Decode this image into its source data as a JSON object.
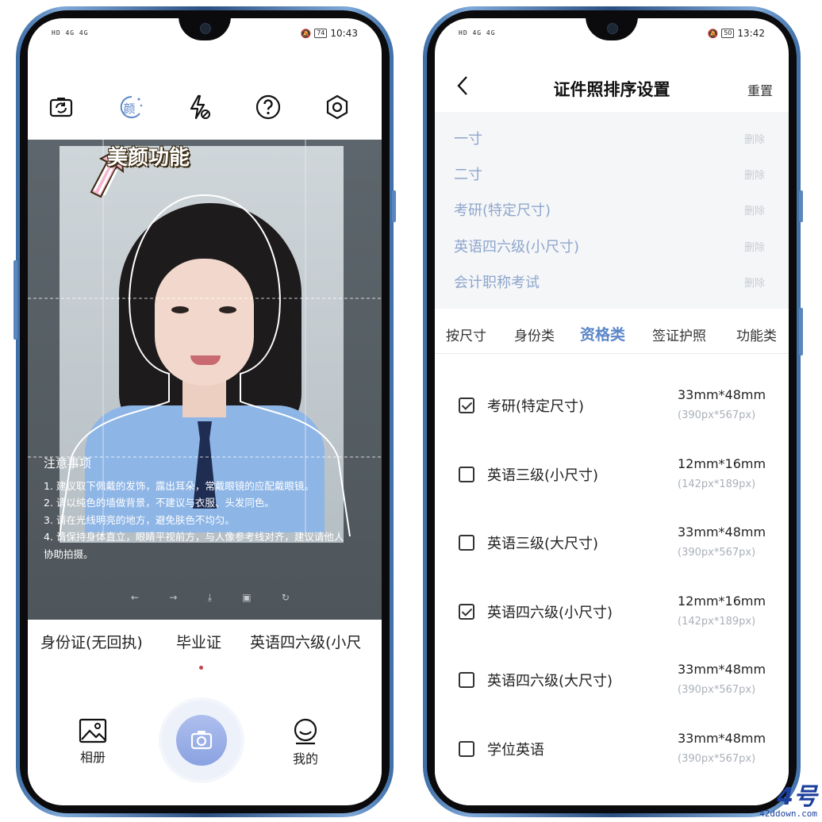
{
  "left_phone": {
    "status": {
      "signal": "HD 4G 4G",
      "battery": "74",
      "time": "10:43"
    },
    "toolbar": {
      "icons": [
        "camera-switch-icon",
        "beauty-icon",
        "flash-off-icon",
        "help-icon",
        "settings-icon"
      ],
      "beauty_glyph": "颜"
    },
    "callout": "美颜功能",
    "notes": {
      "title": "注意事项",
      "items": [
        "1. 建议取下佩戴的发饰，露出耳朵，常戴眼镜的应配戴眼镜。",
        "2. 请以纯色的墙做背景，不建议与衣服、头发同色。",
        "3. 请在光线明亮的地方，避免肤色不均匀。",
        "4. 请保持身体直立，眼睛平视前方，与人像参考线对齐，建议请他人协助拍摄。"
      ]
    },
    "modes": [
      "身份证(无回执)",
      "毕业证",
      "英语四六级(小尺"
    ],
    "nav": {
      "album": "相册",
      "mine": "我的"
    }
  },
  "right_phone": {
    "status": {
      "signal": "HD 4G 4G",
      "battery": "50",
      "time": "13:42"
    },
    "header": {
      "title": "证件照排序设置",
      "reset": "重置"
    },
    "order_items": [
      {
        "label": "一寸",
        "action": "删除"
      },
      {
        "label": "二寸",
        "action": "删除"
      },
      {
        "label": "考研(特定尺寸)",
        "action": "删除"
      },
      {
        "label": "英语四六级(小尺寸)",
        "action": "删除"
      },
      {
        "label": "会计职称考试",
        "action": "删除"
      }
    ],
    "tabs": [
      "按尺寸",
      "身份类",
      "资格类",
      "签证护照",
      "功能类"
    ],
    "active_tab": "资格类",
    "sizes": [
      {
        "name": "考研(特定尺寸)",
        "mm": "33mm*48mm",
        "px": "(390px*567px)",
        "checked": true
      },
      {
        "name": "英语三级(小尺寸)",
        "mm": "12mm*16mm",
        "px": "(142px*189px)",
        "checked": false
      },
      {
        "name": "英语三级(大尺寸)",
        "mm": "33mm*48mm",
        "px": "(390px*567px)",
        "checked": false
      },
      {
        "name": "英语四六级(小尺寸)",
        "mm": "12mm*16mm",
        "px": "(142px*189px)",
        "checked": true
      },
      {
        "name": "英语四六级(大尺寸)",
        "mm": "33mm*48mm",
        "px": "(390px*567px)",
        "checked": false
      },
      {
        "name": "学位英语",
        "mm": "33mm*48mm",
        "px": "(390px*567px)",
        "checked": false
      }
    ]
  },
  "watermark": {
    "brand": "4号",
    "url": "42ddown.com"
  },
  "colors": {
    "accent": "#5a86c8",
    "muted_link": "#8ea6cc",
    "frame": "#3f6fa8"
  }
}
